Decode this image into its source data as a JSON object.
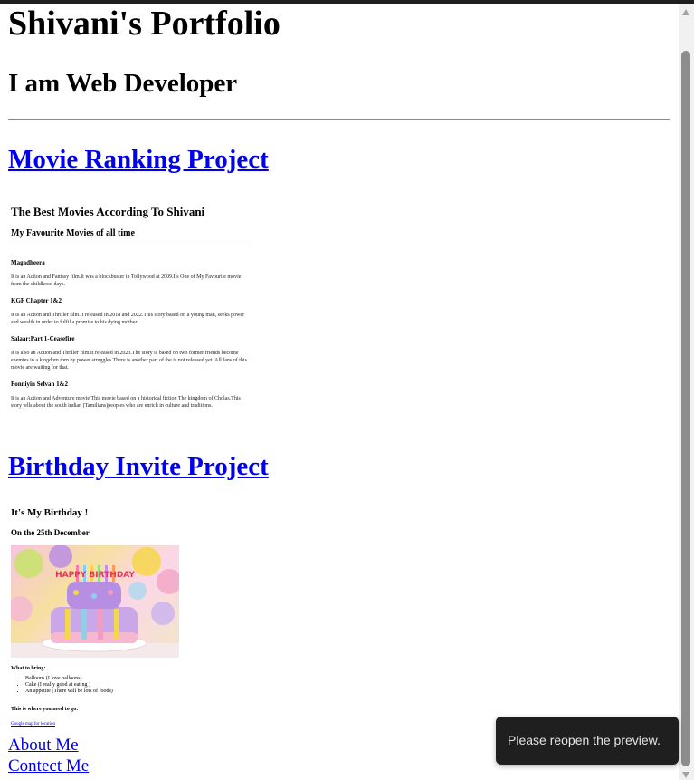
{
  "page": {
    "title": "Shivani's Portfolio",
    "subtitle": "I am Web Developer"
  },
  "projects": [
    {
      "label": "Movie Ranking Project"
    },
    {
      "label": "Birthday Invite Project"
    }
  ],
  "movie_preview": {
    "heading": "The Best Movies According To Shivani",
    "subheading": "My Favourite Movies of all time",
    "movies": [
      {
        "title": "Magadheera",
        "desc": "It is an Action and Fantasy film.It was a blockbuster in Tollywood at 2009.Its One of My Favourite movie from the childhood days."
      },
      {
        "title": "KGF Chapter 1&2",
        "desc": "It is an Action and Thriller film.It released in 2018 and 2022.This story based on a young man, seeks power and wealth in order to fulfil a promise to his dying mother."
      },
      {
        "title": "Salaar:Part 1-Ceasefire",
        "desc": "It is also an Action and Thriller film.It released in 2023.The story is based on two former friends become enemies in a kingdom torn by power struggles.There is another part of the is not released yet. All fans of this movie are waiting for that."
      },
      {
        "title": "Ponniyin Selvan 1&2",
        "desc": "It is an Action and Adventure movie.This movie based on a historical fiction The kingdom of Cholas.This story tells about the south indian (Tamilians)peoples who are enrich in culture and traditions."
      }
    ]
  },
  "birthday_preview": {
    "heading": "It's My Birthday !",
    "date": "On the 25th December",
    "cake_text": "HAPPY BIRTHDAY",
    "bring_heading": "What to bring:",
    "bring_items": [
      "Balloons (I love balloons)",
      "Cake (I really good at eating )",
      "An appetite (There will be lots of foods)"
    ],
    "where_heading": "This is where you need to go:",
    "map_link": "Google map for location"
  },
  "footer_links": {
    "about": "About Me",
    "contact": "Contect Me"
  },
  "toast": {
    "message": "Please reopen the preview."
  },
  "colors": {
    "link": "#0000ee",
    "toast_bg": "#1f1f1f",
    "scroll_thumb": "#8d8d8d"
  }
}
